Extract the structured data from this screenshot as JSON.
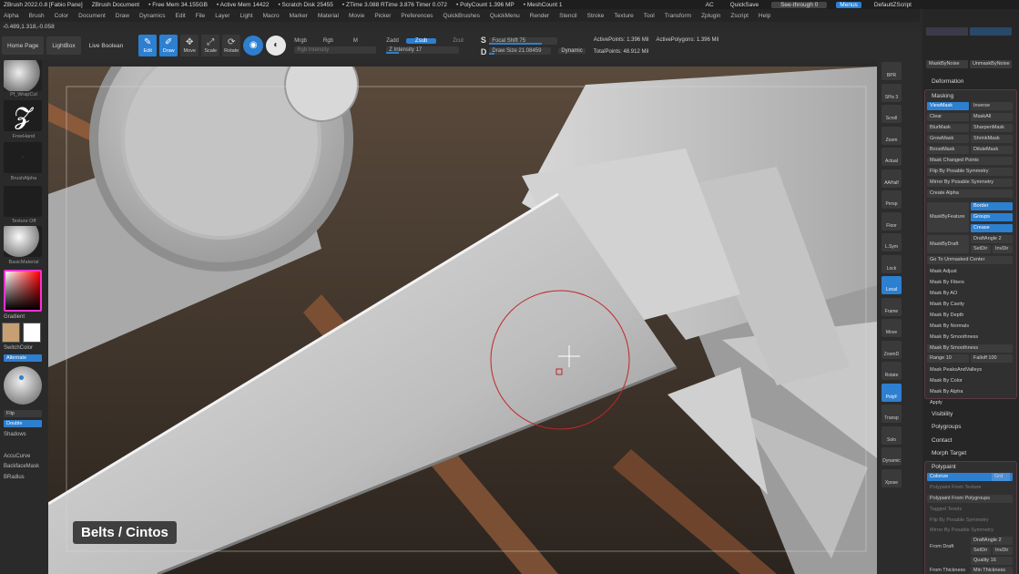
{
  "titlebar": {
    "app": "ZBrush 2022.0.8 [Fabio Pane]",
    "doc": "ZBrush Document",
    "free_mem": "• Free Mem 34.155GB",
    "active_mem": "• Active Mem 14422",
    "scratch": "• Scratch Disk 25455",
    "ztime": "• ZTime 3.088 RTime 3.876 Timer 0.072",
    "polycount": "• PolyCount 1.396 MP",
    "meshcount": "• MeshCount 1",
    "ac": "AC",
    "quicksave": "QuickSave",
    "seethrough": "See-through 0",
    "menus": "Menus",
    "script": "DefaultZScript"
  },
  "menubar": [
    "Alpha",
    "Brush",
    "Color",
    "Document",
    "Draw",
    "Dynamics",
    "Edit",
    "File",
    "Layer",
    "Light",
    "Macro",
    "Marker",
    "Material",
    "Movie",
    "Picker",
    "Preferences",
    "QuickBrushes",
    "QuickMenu",
    "Render",
    "Stencil",
    "Stroke",
    "Texture",
    "Tool",
    "Transform",
    "Zplugin",
    "Zscript",
    "Help"
  ],
  "coords": "-0.489,1.318,-0.058",
  "shelf": {
    "home": "Home Page",
    "lightbox": "LightBox",
    "live_boolean": "Live Boolean",
    "edit": "Edit",
    "draw": "Draw",
    "move": "Move",
    "scale": "Scale",
    "rotate": "Rotate",
    "mrgb": "Mrgb",
    "rgb": "Rgb",
    "m": "M",
    "rgb_intensity": "Rgb Intensity",
    "zadd": "Zadd",
    "zsub": "Zsub",
    "zcut": "Zcut",
    "z_intensity": "Z Intensity 17",
    "focal_shift": "Focal Shift 75",
    "draw_size": "Draw Size 21.08459",
    "dynamic": "Dynamic",
    "active_points": "ActivePoints: 1.396 Mil",
    "active_polygons": "ActivePolygons: 1.396 Mil",
    "total_points": "TotalPoints: 48.912 Mil"
  },
  "lefttray": {
    "brush": "Pf_WrapCut",
    "stroke": "FreeHand",
    "alpha": "BrushAlpha",
    "texture": "Texture Off",
    "material": "BasicMaterial",
    "gradient": "Gradient",
    "switchcolor": "SwitchColor",
    "alternate": "Alternate",
    "flip": "Flip",
    "double": "Double",
    "shadows": "Shadows",
    "accucurve": "AccuCurve",
    "backface": "BackfaceMask",
    "bradius": "BRadius"
  },
  "colors": {
    "main": "#c69f72",
    "secondary": "#ffffff",
    "accent": "#2d7fd0"
  },
  "rightshelf": [
    "BPR",
    "SPix 3",
    "Scroll",
    "Zoom",
    "Actual",
    "AAHalf",
    "Persp",
    "Floor",
    "L.Sym",
    "Lock",
    "Local",
    "Frame",
    "Move",
    "ZoomD",
    "Rotate",
    "PolyF",
    "Transp",
    "Solo",
    "Dynamic",
    "Xpose"
  ],
  "palette": {
    "mask_by_noise": "MaskByNoise",
    "unmask_by_noise": "UnmaskByNoise",
    "deformation": "Deformation",
    "masking": "Masking",
    "viewmask": "ViewMask",
    "inverse": "Inverse",
    "clear": "Clear",
    "maskall": "MaskAll",
    "blurmask": "BlurMask",
    "sharpenmask": "SharpenMask",
    "growmask": "GrowMask",
    "shrinkmask": "ShrinkMask",
    "boostmask": "BoostMask",
    "dilutemask": "DiluteMask",
    "mask_changed_points": "Mask Changed Points",
    "flip_by_sym": "Flip By Posable Symmetry",
    "mirror_by_sym": "Mirror By Posable Symmetry",
    "create_alpha": "Create Alpha",
    "mask_by_feature": "MaskByFeature",
    "border": "Border",
    "groups": "Groups",
    "crease": "Crease",
    "mask_by_draft": "MaskByDraft",
    "draft_angle": "DraftAngle 2",
    "setdir": "SetDir",
    "invdir": "InvDir",
    "go_unmasked": "Go To Unmasked Center",
    "mask_adjust": "Mask Adjust",
    "mask_fibers": "Mask By Fibers",
    "mask_ao": "Mask By AO",
    "mask_cavity": "Mask By Cavity",
    "mask_depth": "Mask By Depth",
    "mask_normals": "Mask By Normals",
    "mask_smoothness": "Mask By Smoothness",
    "mask_smoothness2": "Mask By Smoothness",
    "range": "Range 10",
    "falloff": "Falloff 100",
    "mask_peaks": "Mask PeaksAndValleys",
    "mask_color": "Mask By Color",
    "mask_alpha": "Mask By Alpha",
    "apply": "Apply",
    "visibility": "Visibility",
    "polygroups": "Polygroups",
    "contact": "Contact",
    "morph_target": "Morph Target",
    "polypaint": "Polypaint",
    "colorize": "Colorize",
    "grd": "Grd",
    "pp_from_texture": "Polypaint From Texture",
    "pp_from_polygroups": "Polypaint From Polygroups",
    "tag_texts": "Tagged Texels",
    "flip_sym2": "Flip By Posable Symmetry",
    "mirror_sym2": "Mirror By Posable Symmetry",
    "from_draft": "From Draft",
    "draft_angle2": "DraftAngle 2",
    "quality": "Quality 16",
    "from_thickness": "From Thickness",
    "min_thickness": "Min Thickness"
  },
  "caption": "Belts / Cintos"
}
